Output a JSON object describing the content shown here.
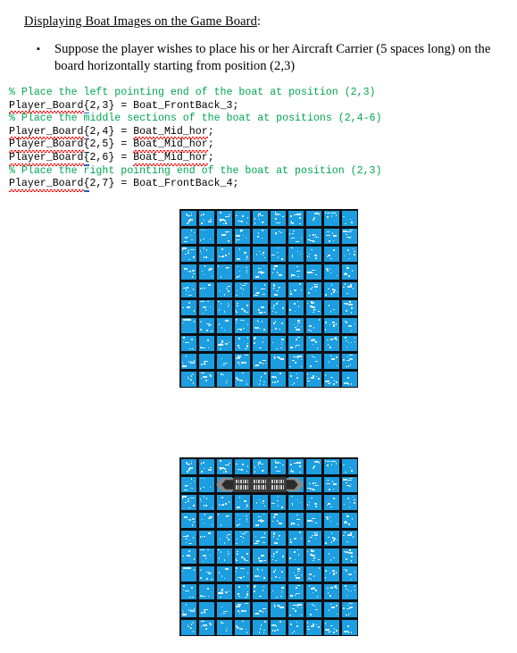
{
  "document": {
    "heading": "Displaying Boat Images on the Game Board",
    "heading_suffix": ":",
    "bullet_marker": "▪",
    "bullet_text": "Suppose the player wishes to place his or her Aircraft Carrier (5 spaces long) on the board horizontally starting from position (2,3)"
  },
  "code": {
    "language": "MATLAB",
    "comment_color": "#00A651",
    "text_color": "#000000",
    "spellcheck_underline_color": "#FF0000",
    "lines": [
      {
        "type": "comment",
        "text": "% Place the left pointing end of the boat at position (2,3)"
      },
      {
        "type": "code",
        "text": "Player_Board{2,3} = Boat_FrontBack_3;"
      },
      {
        "type": "comment",
        "text": "% Place the middle sections of the boat at positions (2,4-6)"
      },
      {
        "type": "code",
        "text": "Player_Board{2,4} = Boat_Mid_hor;"
      },
      {
        "type": "code",
        "text": "Player_Board{2,5} = Boat_Mid_hor;"
      },
      {
        "type": "code",
        "text": "Player_Board{2,6} = Boat_Mid_hor;"
      },
      {
        "type": "comment",
        "text": "% Place the right pointing end of the boat at position (2,3)"
      },
      {
        "type": "code",
        "text": "Player_Board{2,7} = Boat_FrontBack_4;"
      }
    ]
  },
  "boards": {
    "rows": 10,
    "cols": 10,
    "cell_size_px": 20,
    "water_color": "#1C9EE0",
    "grid_line_color": "#0D0F12",
    "speckle_color": "#EAF6FD",
    "boat_hull_color": "#3B3B3B",
    "boat_cap_color": "#8A8A8A",
    "empty_board": {
      "label": "Empty game board",
      "boat_cells": []
    },
    "boat_board": {
      "label": "Game board with Aircraft Carrier placed",
      "boat_row": 2,
      "boat_cols": [
        3,
        4,
        5,
        6,
        7
      ],
      "boat_length": 5,
      "boat_name": "Aircraft Carrier",
      "orientation": "horizontal",
      "pieces": [
        {
          "col": 3,
          "piece": "Boat_FrontBack_3",
          "kind": "cap-left"
        },
        {
          "col": 4,
          "piece": "Boat_Mid_hor",
          "kind": "mid"
        },
        {
          "col": 5,
          "piece": "Boat_Mid_hor",
          "kind": "mid"
        },
        {
          "col": 6,
          "piece": "Boat_Mid_hor",
          "kind": "mid"
        },
        {
          "col": 7,
          "piece": "Boat_FrontBack_4",
          "kind": "cap-right"
        }
      ]
    }
  }
}
